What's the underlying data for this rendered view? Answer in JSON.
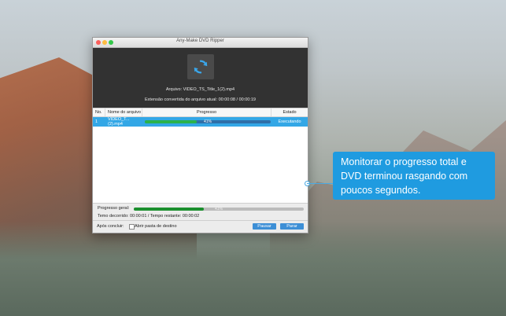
{
  "window": {
    "title": "Any-Make DVD Ripper"
  },
  "header": {
    "file_line": "Arquivo: VIDEO_TS_Title_1(2).mp4",
    "extension_line": "Extensão convertida do arquivo atual: 00:00:08 / 00:00:19"
  },
  "table": {
    "columns": [
      "No.",
      "Nome do arquivo",
      "Progresso",
      "Estado"
    ],
    "rows": [
      {
        "no": "1",
        "name": "VIDEO_T...(2).mp4",
        "progress_label": "41%",
        "progress": 0.41,
        "state": "Executando"
      }
    ]
  },
  "totals": {
    "label": "Progresso geral:",
    "progress_label": "41%",
    "progress": 0.41,
    "time_line": "Temo decorrido: 00:00:01 / Tempo restante: 00:00:02"
  },
  "footer": {
    "after_label": "Após concluir:",
    "open_folder_label": "Abrir pasta de destino",
    "pause_label": "Pausar",
    "stop_label": "Parar"
  },
  "callout": {
    "text": "Monitorar o progresso total e DVD terminou rasgando com poucos segundos."
  },
  "colors": {
    "accent": "#33a7e6",
    "progress": "#2bb24c",
    "callout": "#1f9be0"
  }
}
